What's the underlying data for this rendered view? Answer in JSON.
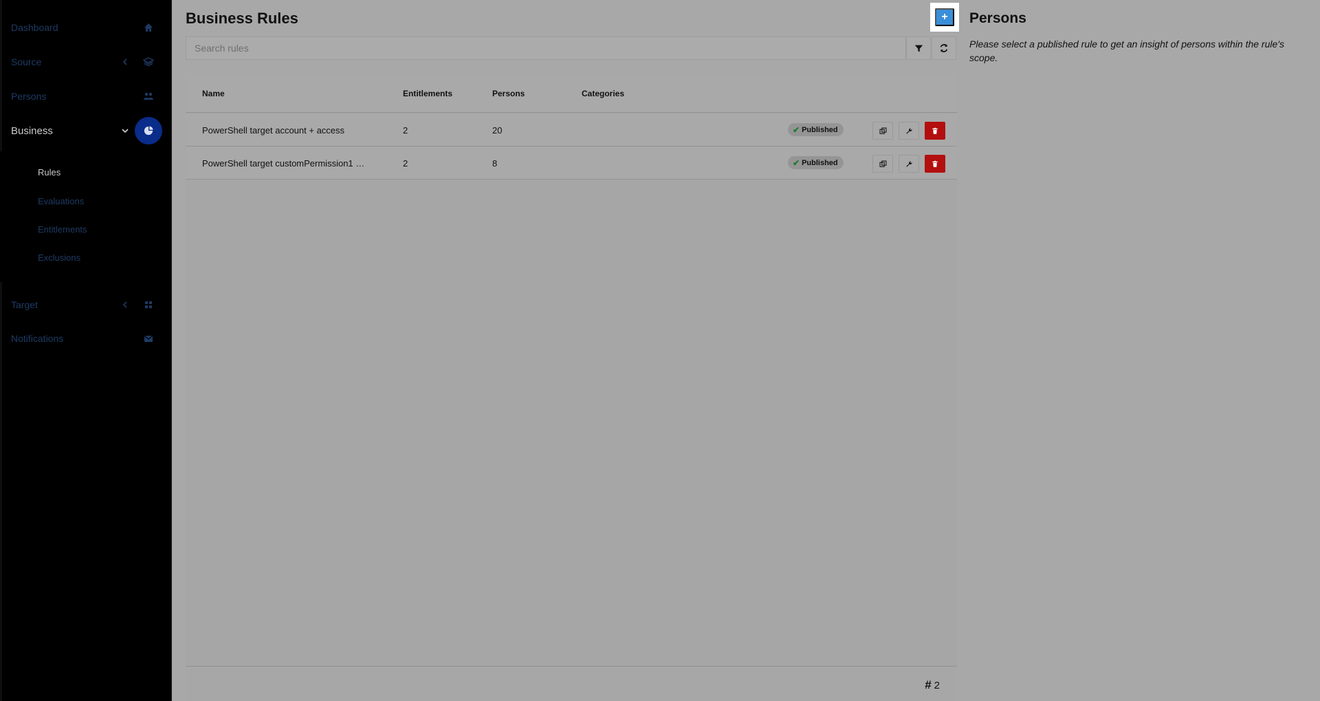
{
  "sidebar": {
    "items": [
      {
        "label": "Dashboard",
        "icon": "home-icon"
      },
      {
        "label": "Source",
        "icon": "layers-icon"
      },
      {
        "label": "Persons",
        "icon": "users-icon"
      },
      {
        "label": "Business",
        "icon": "chart-pie-icon"
      },
      {
        "label": "Target",
        "icon": "grid-icon"
      },
      {
        "label": "Notifications",
        "icon": "envelope-icon"
      }
    ],
    "business_subitems": [
      "Rules",
      "Evaluations",
      "Entitlements",
      "Exclusions"
    ]
  },
  "page": {
    "title_light": "Business",
    "title_bold": "Rules",
    "add_label": "+",
    "search_placeholder": "Search rules"
  },
  "table": {
    "headers": [
      "Name",
      "Entitlements",
      "Persons",
      "Categories"
    ],
    "rows": [
      {
        "name": "PowerShell target account + access",
        "entitlements": "2",
        "persons": "20",
        "categories": "",
        "status": "Published"
      },
      {
        "name": "PowerShell target customPermission1 …",
        "entitlements": "2",
        "persons": "8",
        "categories": "",
        "status": "Published"
      }
    ],
    "count": "2"
  },
  "persons_panel": {
    "title": "Persons",
    "note": "Please select a published rule to get an insight of persons within the rule's scope."
  },
  "colors": {
    "accent": "#3a8fd8",
    "active_nav": "#0a2c8a",
    "danger": "#b30f0f",
    "published_check": "#1f7a2e"
  }
}
